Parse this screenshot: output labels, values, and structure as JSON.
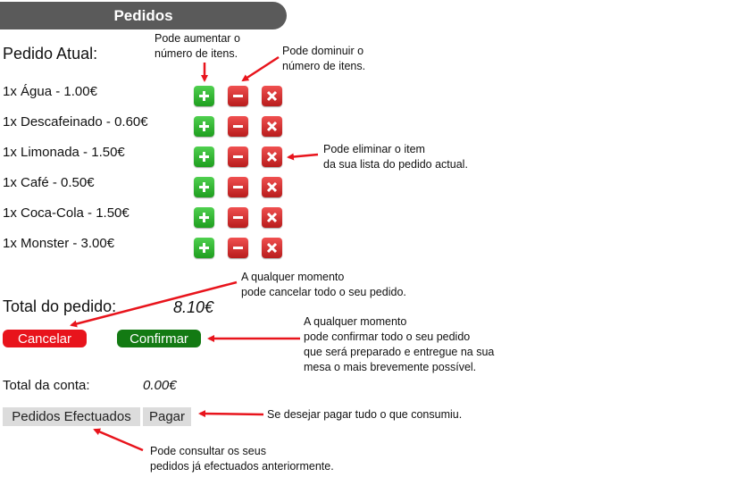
{
  "header": {
    "title": "Pedidos"
  },
  "order": {
    "label": "Pedido Atual:",
    "items": [
      {
        "label": "1x Água - 1.00€"
      },
      {
        "label": "1x Descafeinado - 0.60€"
      },
      {
        "label": "1x Limonada - 1.50€"
      },
      {
        "label": "1x Café - 0.50€"
      },
      {
        "label": "1x Coca-Cola - 1.50€"
      },
      {
        "label": "1x Monster - 3.00€"
      }
    ],
    "total_label": "Total do pedido:",
    "total_value": "8.10€"
  },
  "actions": {
    "cancel_label": "Cancelar",
    "confirm_label": "Confirmar"
  },
  "account": {
    "label": "Total da conta:",
    "value": "0.00€"
  },
  "footer": {
    "orders_label": "Pedidos Efectuados",
    "pay_label": "Pagar"
  },
  "annotations": {
    "increase": [
      "Pode aumentar o",
      "número de itens."
    ],
    "decrease": [
      "Pode dominuir o",
      "número de itens."
    ],
    "delete": [
      "Pode eliminar o item",
      "da sua lista do pedido actual."
    ],
    "cancel": [
      "A qualquer momento",
      "pode cancelar todo o seu pedido."
    ],
    "confirm": [
      "A qualquer momento",
      "pode confirmar todo o seu pedido",
      "que será preparado e entregue na sua",
      "mesa o mais brevemente possível."
    ],
    "pay": [
      "Se desejar pagar tudo o que consumiu."
    ],
    "orders": [
      "Pode consultar os seus",
      "pedidos já efectuados anteriormente."
    ]
  },
  "colors": {
    "header_bg": "#5a5a5a",
    "plus": "#2fb52f",
    "minus_delete": "#d42020",
    "cancel": "#e8141c",
    "confirm": "#137a13",
    "arrow": "#e8141c",
    "gray_button": "#dcdcdc"
  },
  "icons": {
    "plus": "plus-icon",
    "minus": "minus-icon",
    "delete": "close-icon"
  }
}
